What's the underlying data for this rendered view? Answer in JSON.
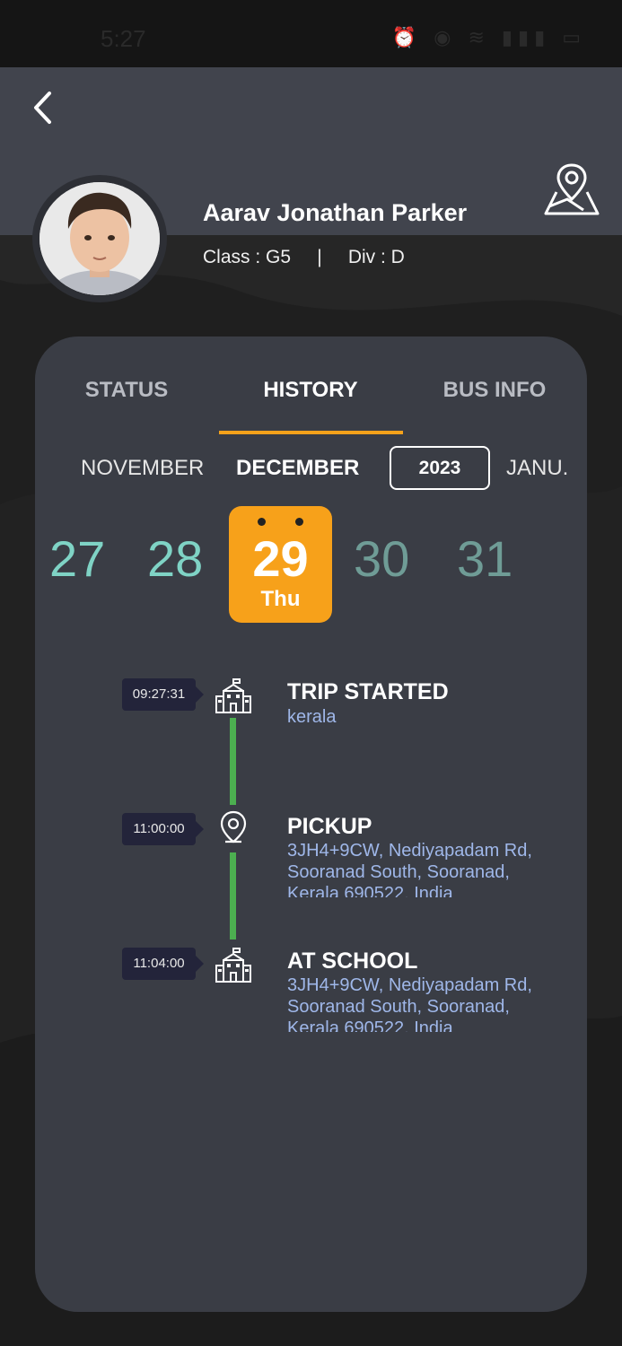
{
  "status_bar": {
    "time": "5:27"
  },
  "student": {
    "name": "Aarav Jonathan Parker",
    "class_line": "Class : G5     |     Div : D"
  },
  "tabs": [
    {
      "label": "STATUS"
    },
    {
      "label": "HISTORY"
    },
    {
      "label": "BUS INFO"
    }
  ],
  "months": {
    "prev": "NOVEMBER",
    "current": "DECEMBER",
    "year": "2023",
    "next": "JANU."
  },
  "days": {
    "d1": "27",
    "d2": "28",
    "selected_num": "29",
    "selected_dow": "Thu",
    "d4": "30",
    "d5": "31"
  },
  "timeline": [
    {
      "time": "09:27:31",
      "title": "TRIP STARTED",
      "subtitle": "kerala",
      "icon": "school-icon"
    },
    {
      "time": "11:00:00",
      "title": "PICKUP",
      "subtitle": "3JH4+9CW, Nediyapadam Rd, Sooranad South, Sooranad, Kerala 690522, India",
      "icon": "location-pin-icon"
    },
    {
      "time": "11:04:00",
      "title": "AT SCHOOL",
      "subtitle": "3JH4+9CW, Nediyapadam Rd, Sooranad South, Sooranad, Kerala 690522, India",
      "icon": "school-icon"
    }
  ],
  "colors": {
    "accent": "#f7a11a",
    "timeline_line": "#4caf50",
    "card_bg": "#3a3d45",
    "header_bg": "#41444d",
    "subtitle": "#9fb7e9"
  }
}
